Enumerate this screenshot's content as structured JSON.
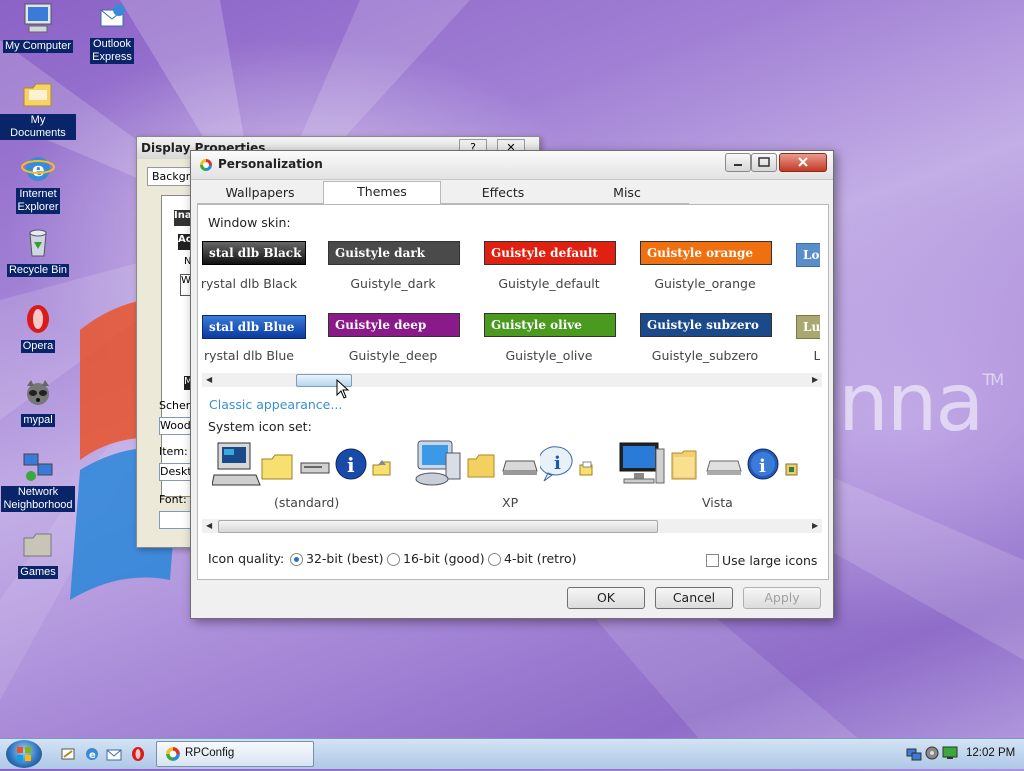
{
  "desktop": {
    "brand_text": "nna",
    "brand_tm": "TM",
    "icons": [
      {
        "label": "My Computer"
      },
      {
        "label_line1": "Outlook",
        "label_line2": "Express"
      },
      {
        "label": "My Documents"
      },
      {
        "label_line1": "Internet",
        "label_line2": "Explorer"
      },
      {
        "label": "Recycle Bin"
      },
      {
        "label": "Opera"
      },
      {
        "label": "mypal"
      },
      {
        "label_line1": "Network",
        "label_line2": "Neighborhood"
      },
      {
        "label": "Games"
      }
    ]
  },
  "display_properties": {
    "title": "Display Properties",
    "help_glyph": "?",
    "close_glyph": "✕",
    "tab_background": "Backgro",
    "schem_label": "Schem",
    "scheme_value": "Wood",
    "item_label": "Item:",
    "item_value": "Deskt",
    "font_label": "Font:",
    "preview_ina": "Ina",
    "preview_ac": "Ac",
    "preview_n": "N",
    "preview_w": "W",
    "preview_m": "M"
  },
  "window": {
    "title": "Personalization",
    "tabs": [
      "Wallpapers",
      "Themes",
      "Effects",
      "Misc"
    ],
    "active_tab": "Themes",
    "window_skin_label": "Window skin:",
    "skins_row1": [
      {
        "bar": "stal dlb Black",
        "name": "rystal dlb Black",
        "color": "#1a1a1a"
      },
      {
        "bar": "Guistyle dark",
        "name": "Guistyle_dark",
        "color": "#4a4a4a"
      },
      {
        "bar": "Guistyle default",
        "name": "Guistyle_default",
        "color": "#e02010"
      },
      {
        "bar": "Guistyle orange",
        "name": "Guistyle_orange",
        "color": "#f07010"
      },
      {
        "bar": "Lo",
        "name": "",
        "color": "#5a8ec8"
      }
    ],
    "skins_row2": [
      {
        "bar": "stal dlb Blue",
        "name": "rystal dlb Blue",
        "color": "#1050b0"
      },
      {
        "bar": "Guistyle deep",
        "name": "Guistyle_deep",
        "color": "#8a1a8a"
      },
      {
        "bar": "Guistyle olive",
        "name": "Guistyle_olive",
        "color": "#4a9a20"
      },
      {
        "bar": "Guistyle subzero",
        "name": "Guistyle_subzero",
        "color": "#1a4a8a"
      },
      {
        "bar": "Lu",
        "name": "L",
        "color": "#a8a870"
      }
    ],
    "classic_link": "Classic appearance...",
    "system_icon_set_label": "System icon set:",
    "icon_sets": [
      "(standard)",
      "XP",
      "Vista"
    ],
    "icon_quality_label": "Icon quality:",
    "quality_options": [
      "32-bit (best)",
      "16-bit (good)",
      "4-bit (retro)"
    ],
    "quality_selected": "32-bit (best)",
    "large_icons_label": "Use large icons",
    "large_icons_checked": false,
    "buttons": {
      "ok": "OK",
      "cancel": "Cancel",
      "apply": "Apply"
    }
  },
  "taskbar": {
    "task_label": "RPConfig",
    "clock": "12:02 PM"
  }
}
